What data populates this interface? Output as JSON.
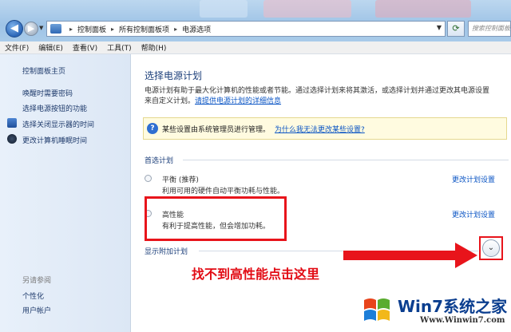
{
  "address": {
    "crumbs": [
      "控制面板",
      "所有控制面板项",
      "电源选项"
    ],
    "search_placeholder": "搜索控制面板"
  },
  "menu": [
    "文件(F)",
    "编辑(E)",
    "查看(V)",
    "工具(T)",
    "帮助(H)"
  ],
  "sidebar": {
    "home": "控制面板主页",
    "links": [
      "唤醒时需要密码",
      "选择电源按钮的功能",
      "选择关闭显示器的时间",
      "更改计算机睡眠时间"
    ],
    "see_also_title": "另请参阅",
    "see_also": [
      "个性化",
      "用户帐户"
    ]
  },
  "main": {
    "title": "选择电源计划",
    "desc_line1": "电源计划有助于最大化计算机的性能或者节能。通过选择计划来将其激活，或选择计划并通过更改其电源设置",
    "desc_line2_prefix": "来自定义计划。",
    "desc_link": "请提供电源计划的详细信息",
    "info_text": "某些设置由系统管理员进行管理。",
    "info_link": "为什么我无法更改某些设置?",
    "preferred_label": "首选计划",
    "plans": [
      {
        "name": "平衡 (推荐)",
        "desc": "利用可用的硬件自动平衡功耗与性能。",
        "link": "更改计划设置"
      },
      {
        "name": "高性能",
        "desc": "有利于提高性能，但会增加功耗。",
        "link": "更改计划设置"
      }
    ],
    "additional_label": "显示附加计划",
    "annotation": "找不到高性能点击这里"
  },
  "watermark": {
    "brand": "Win7系统之家",
    "url": "Www.Winwin7.com"
  },
  "colors": {
    "accent_red": "#e8141b",
    "link_blue": "#0b55c4",
    "title_blue": "#1c3f7a"
  }
}
